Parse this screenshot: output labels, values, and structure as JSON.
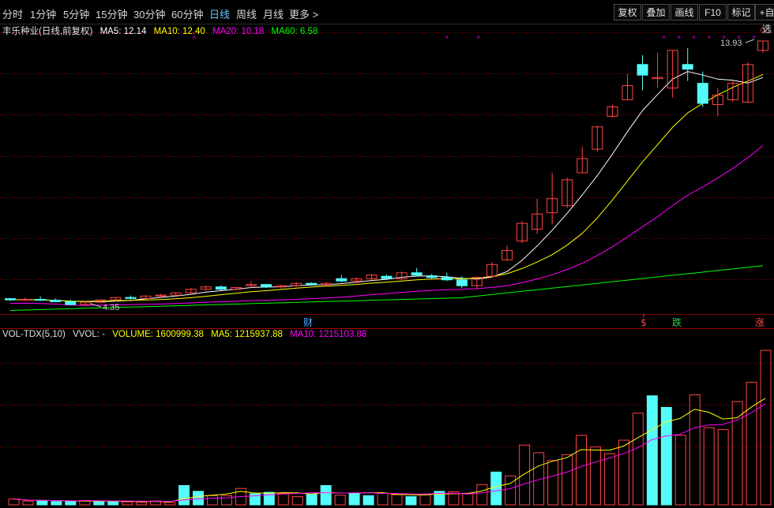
{
  "toolbar": {
    "tabs": [
      {
        "label": "分时",
        "active": false
      },
      {
        "label": "1分钟",
        "active": false
      },
      {
        "label": "5分钟",
        "active": false
      },
      {
        "label": "15分钟",
        "active": false
      },
      {
        "label": "30分钟",
        "active": false
      },
      {
        "label": "60分钟",
        "active": false
      },
      {
        "label": "日线",
        "active": true
      },
      {
        "label": "周线",
        "active": false
      },
      {
        "label": "月线",
        "active": false
      },
      {
        "label": "更多 >",
        "active": false
      }
    ],
    "right_buttons": [
      "复权",
      "叠加",
      "画线",
      "F10",
      "标记",
      "+自选"
    ]
  },
  "price_legend": {
    "title": "丰乐种业(日线,前复权)",
    "ma5": "MA5: 12.14",
    "ma10": "MA10: 12.40",
    "ma20": "MA20: 10.18",
    "ma60": "MA60: 6.58"
  },
  "vol_legend": {
    "indicator": "VOL-TDX(5,10)",
    "vvol": "VVOL: -",
    "volume": "VOLUME: 1600999.38",
    "ma5": "MA5: 1215937.88",
    "ma10": "MA10: 1215103.88"
  },
  "colors": {
    "up": "#ff4444",
    "down": "#54fcfc",
    "ma5": "#ffffff",
    "ma10": "#ffff00",
    "ma20": "#ff00ff",
    "ma60": "#00ff00",
    "grid": "#800000",
    "active_tab": "#62c8ff"
  },
  "chart_data": {
    "type": "candlestick",
    "price_labels": {
      "high": "13.93",
      "low": "4.35"
    },
    "ohlc": [
      [
        4.65,
        4.68,
        4.55,
        4.6
      ],
      [
        4.6,
        4.7,
        4.55,
        4.62
      ],
      [
        4.62,
        4.75,
        4.55,
        4.58
      ],
      [
        4.58,
        4.66,
        4.5,
        4.52
      ],
      [
        4.52,
        4.6,
        4.38,
        4.4
      ],
      [
        4.4,
        4.55,
        4.35,
        4.5
      ],
      [
        4.5,
        4.62,
        4.45,
        4.6
      ],
      [
        4.6,
        4.72,
        4.52,
        4.7
      ],
      [
        4.7,
        4.78,
        4.62,
        4.66
      ],
      [
        4.66,
        4.8,
        4.6,
        4.76
      ],
      [
        4.76,
        4.85,
        4.7,
        4.8
      ],
      [
        4.8,
        4.92,
        4.74,
        4.9
      ],
      [
        4.9,
        5.1,
        4.85,
        5.05
      ],
      [
        5.05,
        5.2,
        4.98,
        5.15
      ],
      [
        5.15,
        5.22,
        5.0,
        5.05
      ],
      [
        5.05,
        5.15,
        5.0,
        5.12
      ],
      [
        5.2,
        5.4,
        5.1,
        5.25
      ],
      [
        5.25,
        5.28,
        5.1,
        5.15
      ],
      [
        5.15,
        5.25,
        5.08,
        5.2
      ],
      [
        5.2,
        5.35,
        5.15,
        5.3
      ],
      [
        5.3,
        5.35,
        5.2,
        5.25
      ],
      [
        5.25,
        5.35,
        5.18,
        5.3
      ],
      [
        5.5,
        5.65,
        5.35,
        5.4
      ],
      [
        5.4,
        5.55,
        5.3,
        5.5
      ],
      [
        5.5,
        5.7,
        5.45,
        5.65
      ],
      [
        5.6,
        5.68,
        5.48,
        5.5
      ],
      [
        5.5,
        5.8,
        5.45,
        5.75
      ],
      [
        5.75,
        5.95,
        5.6,
        5.65
      ],
      [
        5.62,
        5.7,
        5.5,
        5.55
      ],
      [
        5.55,
        5.75,
        5.4,
        5.45
      ],
      [
        5.45,
        5.6,
        5.1,
        5.2
      ],
      [
        5.2,
        5.6,
        5.05,
        5.55
      ],
      [
        5.6,
        6.2,
        5.55,
        6.1
      ],
      [
        6.3,
        6.9,
        6.25,
        6.7
      ],
      [
        7.1,
        7.95,
        7.0,
        7.85
      ],
      [
        7.6,
        8.9,
        7.4,
        8.25
      ],
      [
        8.3,
        10.0,
        7.8,
        8.9
      ],
      [
        8.6,
        9.8,
        8.5,
        9.7
      ],
      [
        10.0,
        11.1,
        10.0,
        10.6
      ],
      [
        11.0,
        12.0,
        10.9,
        11.95
      ],
      [
        12.4,
        12.9,
        12.35,
        12.8
      ],
      [
        13.1,
        14.2,
        13.1,
        13.7
      ],
      [
        14.6,
        15.0,
        13.5,
        14.15
      ],
      [
        14.0,
        15.1,
        13.6,
        14.05
      ],
      [
        13.6,
        15.2,
        13.2,
        15.2
      ],
      [
        14.6,
        15.3,
        13.9,
        14.4
      ],
      [
        13.8,
        14.3,
        12.8,
        12.95
      ],
      [
        12.9,
        13.6,
        12.4,
        13.3
      ],
      [
        13.1,
        13.9,
        13.0,
        13.8
      ],
      [
        13.0,
        14.7,
        13.0,
        14.6
      ],
      [
        15.2,
        15.6,
        15.1,
        15.6
      ]
    ],
    "volume": [
      60000,
      40000,
      40000,
      35000,
      35000,
      45000,
      40000,
      35000,
      30000,
      25000,
      40000,
      25000,
      200000,
      140000,
      95000,
      95000,
      170000,
      115000,
      130000,
      120000,
      85000,
      110000,
      200000,
      100000,
      120000,
      95000,
      120000,
      105000,
      85000,
      110000,
      140000,
      135000,
      120000,
      210000,
      340000,
      300000,
      620000,
      540000,
      460000,
      520000,
      720000,
      600000,
      530000,
      670000,
      950000,
      1130000,
      1010000,
      720000,
      1140000,
      800000,
      780000,
      1070000,
      1270000,
      1600999
    ],
    "ma_volume": {
      "ma5_label": "MA5: 1215937.88",
      "ma10_label": "MA10: 1215103.88"
    },
    "markers": [
      {
        "label": "财",
        "color": "#4da6ff"
      },
      {
        "label": "$",
        "color": "#ff4444"
      },
      {
        "label": "跌",
        "color": "#30d050"
      },
      {
        "label": "涨",
        "color": "#ff4444"
      }
    ],
    "ylim_price": [
      4.0,
      16.0
    ],
    "ylim_volume": [
      0,
      1700000
    ]
  }
}
